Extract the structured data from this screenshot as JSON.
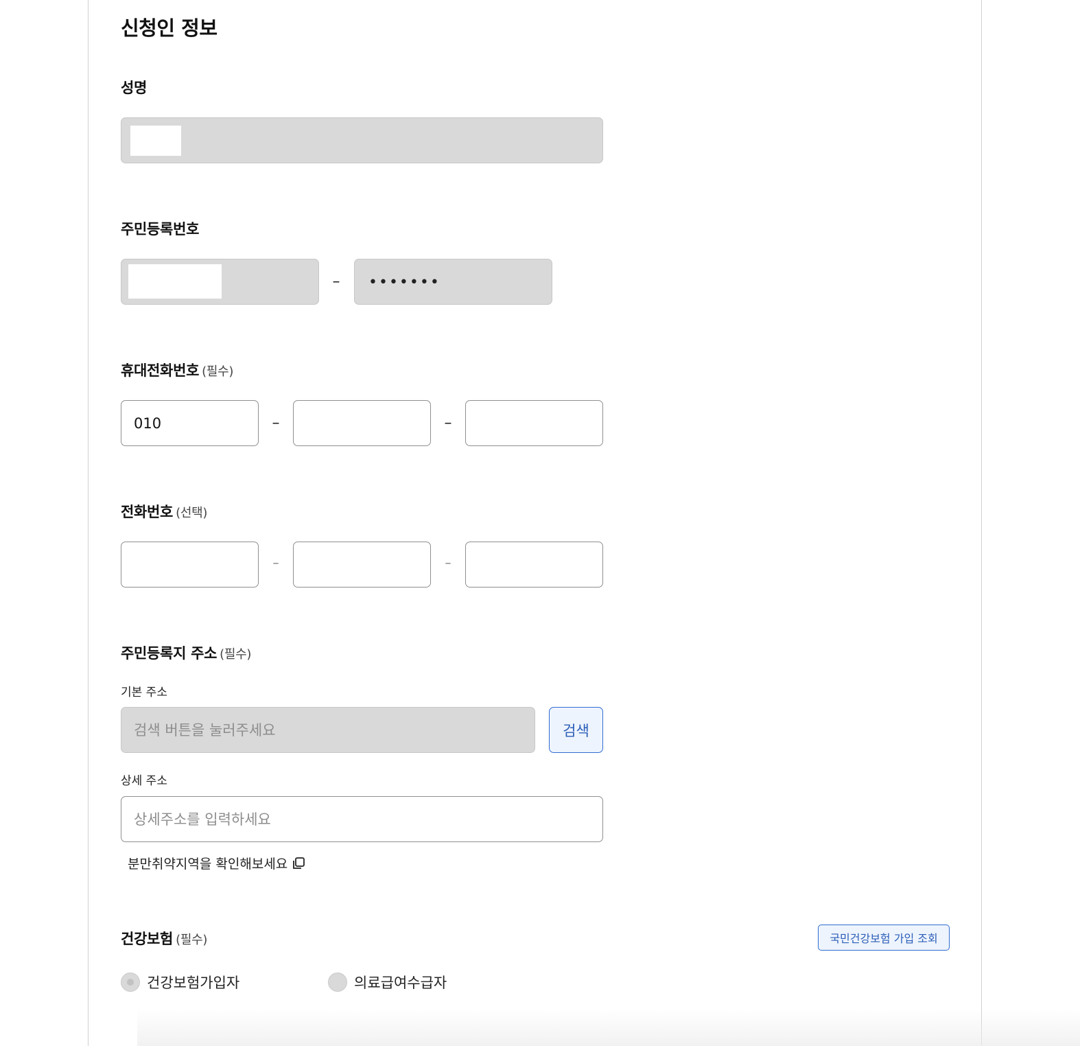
{
  "section": {
    "title": "신청인 정보"
  },
  "name": {
    "label": "성명"
  },
  "rrn": {
    "label": "주민등록번호",
    "back_masked": "•••••••",
    "separator": "–"
  },
  "mobile": {
    "label": "휴대전화번호",
    "required": "(필수)",
    "part1": "010",
    "part2": "",
    "part3": "",
    "separator": "–"
  },
  "phone": {
    "label": "전화번호",
    "optional": "(선택)",
    "part1": "",
    "part2": "",
    "part3": "",
    "separator": "–"
  },
  "address": {
    "label": "주민등록지 주소",
    "required": "(필수)",
    "basic_label": "기본 주소",
    "basic_placeholder": "검색 버튼을 눌러주세요",
    "search_button": "검색",
    "detail_label": "상세 주소",
    "detail_placeholder": "상세주소를 입력하세요",
    "vulnerable_link": "분만취약지역을 확인해보세요"
  },
  "insurance": {
    "label": "건강보험",
    "required": "(필수)",
    "lookup_button": "국민건강보험 가입 조회",
    "options": [
      {
        "label": "건강보험가입자",
        "checked": true
      },
      {
        "label": "의료급여수급자",
        "checked": false
      }
    ]
  },
  "colors": {
    "accent": "#2f6cd1",
    "accent_bg": "#eef4fd",
    "disabled_bg": "#d9d9d9"
  }
}
